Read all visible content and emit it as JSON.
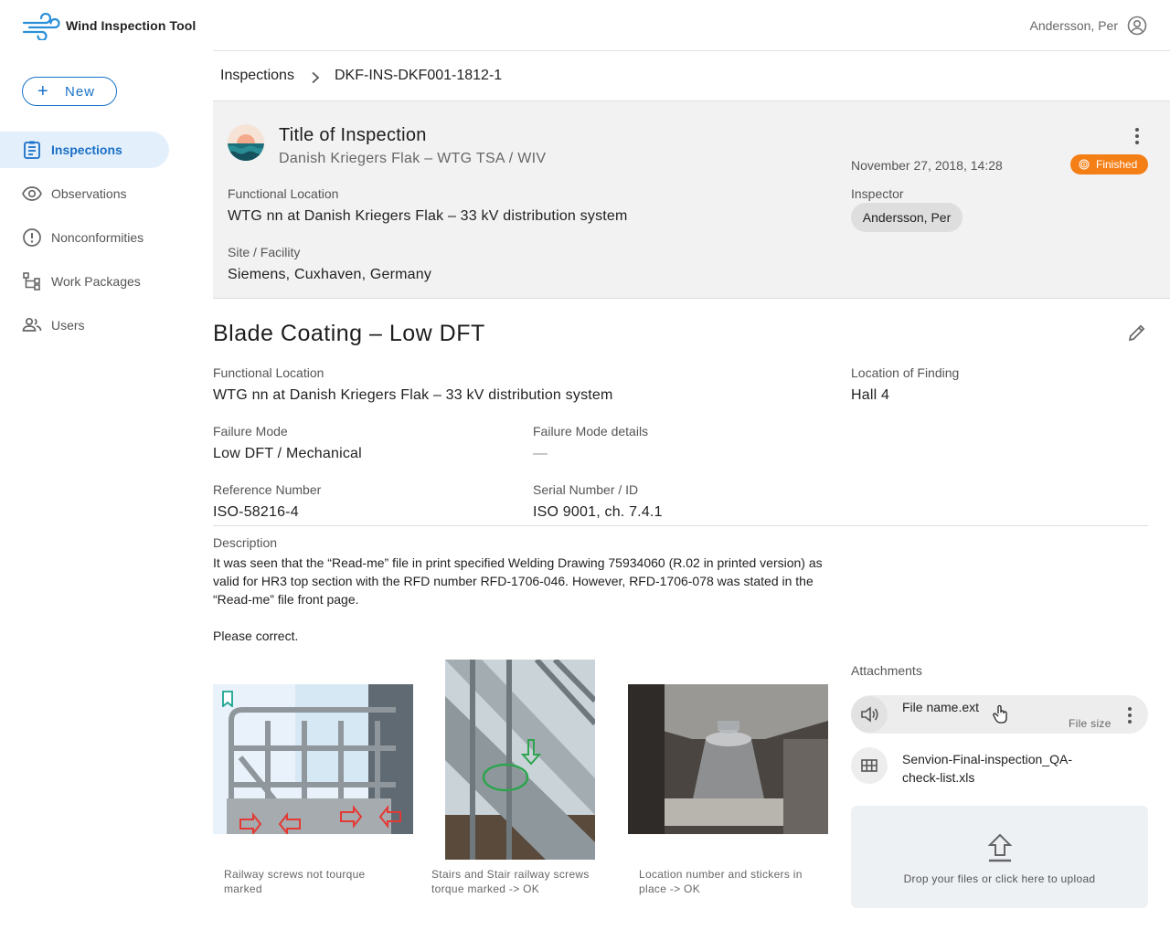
{
  "app": {
    "title": "Wind Inspection Tool",
    "user": "Andersson, Per"
  },
  "sidebar": {
    "new_label": "New",
    "items": [
      {
        "label": "Inspections",
        "icon": "clipboard-icon",
        "active": true
      },
      {
        "label": "Observations",
        "icon": "eye-icon",
        "active": false
      },
      {
        "label": "Nonconformities",
        "icon": "alert-circle-icon",
        "active": false
      },
      {
        "label": "Work Packages",
        "icon": "hierarchy-icon",
        "active": false
      },
      {
        "label": "Users",
        "icon": "users-icon",
        "active": false
      }
    ]
  },
  "breadcrumb": {
    "root": "Inspections",
    "current": "DKF-INS-DKF001-1812-1"
  },
  "inspection": {
    "title": "Title of Inspection",
    "subtitle": "Danish Kriegers Flak – WTG TSA / WIV",
    "date": "November 27, 2018, 14:28",
    "status": "Finished",
    "functional_location_label": "Functional Location",
    "functional_location": "WTG nn at Danish Kriegers Flak – 33 kV distribution system",
    "site_label": "Site / Facility",
    "site": "Siemens, Cuxhaven, Germany",
    "inspector_label": "Inspector",
    "inspector": "Andersson, Per"
  },
  "finding": {
    "title": "Blade Coating – Low DFT",
    "functional_location_label": "Functional Location",
    "functional_location": "WTG nn at Danish Kriegers Flak – 33 kV distribution system",
    "location_label": "Location of Finding",
    "location": "Hall 4",
    "failure_mode_label": "Failure Mode",
    "failure_mode": "Low DFT / Mechanical",
    "failure_details_label": "Failure Mode details",
    "failure_details": "—",
    "reference_label": "Reference Number",
    "reference": "ISO-58216-4",
    "serial_label": "Serial Number / ID",
    "serial": "ISO 9001, ch. 7.4.1",
    "description_label": "Description",
    "description_p1": "It was seen that the “Read-me” file in print specified Welding Drawing 75934060 (R.02 in printed version) as valid for HR3 top section with the RFD number RFD-1706-046. However, RFD-1706-078 was stated in the “Read-me” file front page.",
    "description_p2": "Please correct."
  },
  "photos": [
    {
      "caption": "Railway screws not tourque marked"
    },
    {
      "caption": "Stairs and Stair railway screws torque marked -> OK"
    },
    {
      "caption": "Location number and stickers in place -> OK"
    }
  ],
  "attachments": {
    "title": "Attachments",
    "files": [
      {
        "name": "File name.ext",
        "size": "File size",
        "icon": "speaker-icon"
      },
      {
        "name": "Senvion-Final-inspection_QA-check-list.xls",
        "icon": "table-icon"
      }
    ],
    "drop_label": "Drop your files or click here to upload"
  },
  "colors": {
    "accent": "#1a73c8",
    "status_finished": "#f57f17"
  }
}
